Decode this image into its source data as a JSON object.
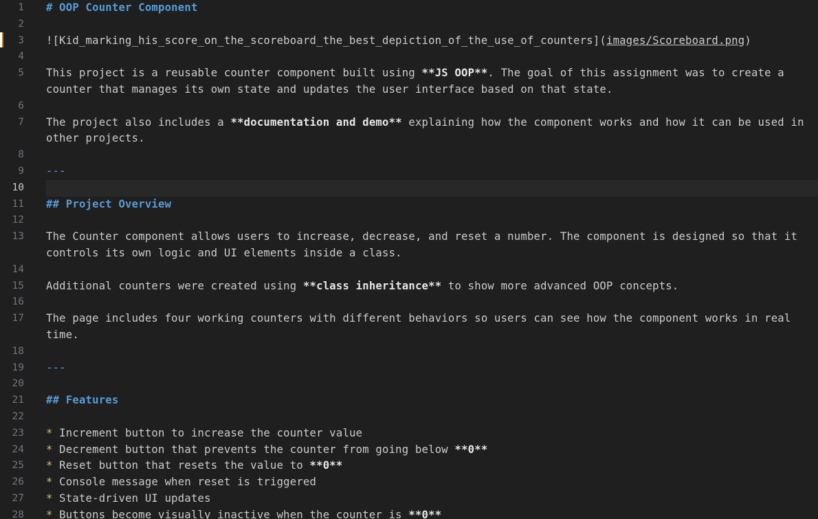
{
  "editor": {
    "current_line": "10",
    "lines": [
      {
        "n": "1",
        "parts": [
          {
            "t": "# OOP Counter Component",
            "c": "heading"
          }
        ]
      },
      {
        "n": "2",
        "parts": []
      },
      {
        "n": "3",
        "parts": [
          {
            "t": "![Kid_marking_his_score_on_the_scoreboard_the_best_depiction_of_the_use_of_counters](",
            "c": ""
          },
          {
            "t": "images/Scoreboard.png",
            "c": "link-url"
          },
          {
            "t": ")",
            "c": ""
          }
        ]
      },
      {
        "n": "4",
        "parts": []
      },
      {
        "n": "5",
        "parts": [
          {
            "t": "This project is a reusable counter component built using ",
            "c": ""
          },
          {
            "t": "**JS OOP**",
            "c": "bold"
          },
          {
            "t": ". The goal of this assignment was to create a counter that manages its own state and updates the user interface based on that state.",
            "c": ""
          }
        ]
      },
      {
        "n": "6",
        "parts": []
      },
      {
        "n": "7",
        "parts": [
          {
            "t": "The project also includes a ",
            "c": ""
          },
          {
            "t": "**documentation and demo**",
            "c": "bold"
          },
          {
            "t": " explaining how the component works and how it can be used in other projects.",
            "c": ""
          }
        ]
      },
      {
        "n": "8",
        "parts": []
      },
      {
        "n": "9",
        "parts": [
          {
            "t": "---",
            "c": "rule"
          }
        ]
      },
      {
        "n": "10",
        "parts": []
      },
      {
        "n": "11",
        "parts": [
          {
            "t": "## Project Overview",
            "c": "heading"
          }
        ]
      },
      {
        "n": "12",
        "parts": []
      },
      {
        "n": "13",
        "parts": [
          {
            "t": "The Counter component allows users to increase, decrease, and reset a number. The component is designed so that it controls its own logic and UI elements inside a class.",
            "c": ""
          }
        ]
      },
      {
        "n": "14",
        "parts": []
      },
      {
        "n": "15",
        "parts": [
          {
            "t": "Additional counters were created using ",
            "c": ""
          },
          {
            "t": "**class inheritance**",
            "c": "bold"
          },
          {
            "t": " to show more advanced OOP concepts.",
            "c": ""
          }
        ]
      },
      {
        "n": "16",
        "parts": []
      },
      {
        "n": "17",
        "parts": [
          {
            "t": "The page includes four working counters with different behaviors so users can see how the component works in real time.",
            "c": ""
          }
        ]
      },
      {
        "n": "18",
        "parts": []
      },
      {
        "n": "19",
        "parts": [
          {
            "t": "---",
            "c": "rule"
          }
        ]
      },
      {
        "n": "20",
        "parts": []
      },
      {
        "n": "21",
        "parts": [
          {
            "t": "## Features",
            "c": "heading"
          }
        ]
      },
      {
        "n": "22",
        "parts": []
      },
      {
        "n": "23",
        "parts": [
          {
            "t": "*",
            "c": "bullet"
          },
          {
            "t": " Increment button to increase the counter value",
            "c": ""
          }
        ]
      },
      {
        "n": "24",
        "parts": [
          {
            "t": "*",
            "c": "bullet"
          },
          {
            "t": " Decrement button that prevents the counter from going below ",
            "c": ""
          },
          {
            "t": "**0**",
            "c": "bold"
          }
        ]
      },
      {
        "n": "25",
        "parts": [
          {
            "t": "*",
            "c": "bullet"
          },
          {
            "t": " Reset button that resets the value to ",
            "c": ""
          },
          {
            "t": "**0**",
            "c": "bold"
          }
        ]
      },
      {
        "n": "26",
        "parts": [
          {
            "t": "*",
            "c": "bullet"
          },
          {
            "t": " Console message when reset is triggered",
            "c": ""
          }
        ]
      },
      {
        "n": "27",
        "parts": [
          {
            "t": "*",
            "c": "bullet"
          },
          {
            "t": " State-driven UI updates",
            "c": ""
          }
        ]
      },
      {
        "n": "28",
        "parts": [
          {
            "t": "*",
            "c": "bullet"
          },
          {
            "t": " Buttons become visually inactive when the counter is ",
            "c": ""
          },
          {
            "t": "**0**",
            "c": "bold"
          }
        ]
      }
    ]
  }
}
